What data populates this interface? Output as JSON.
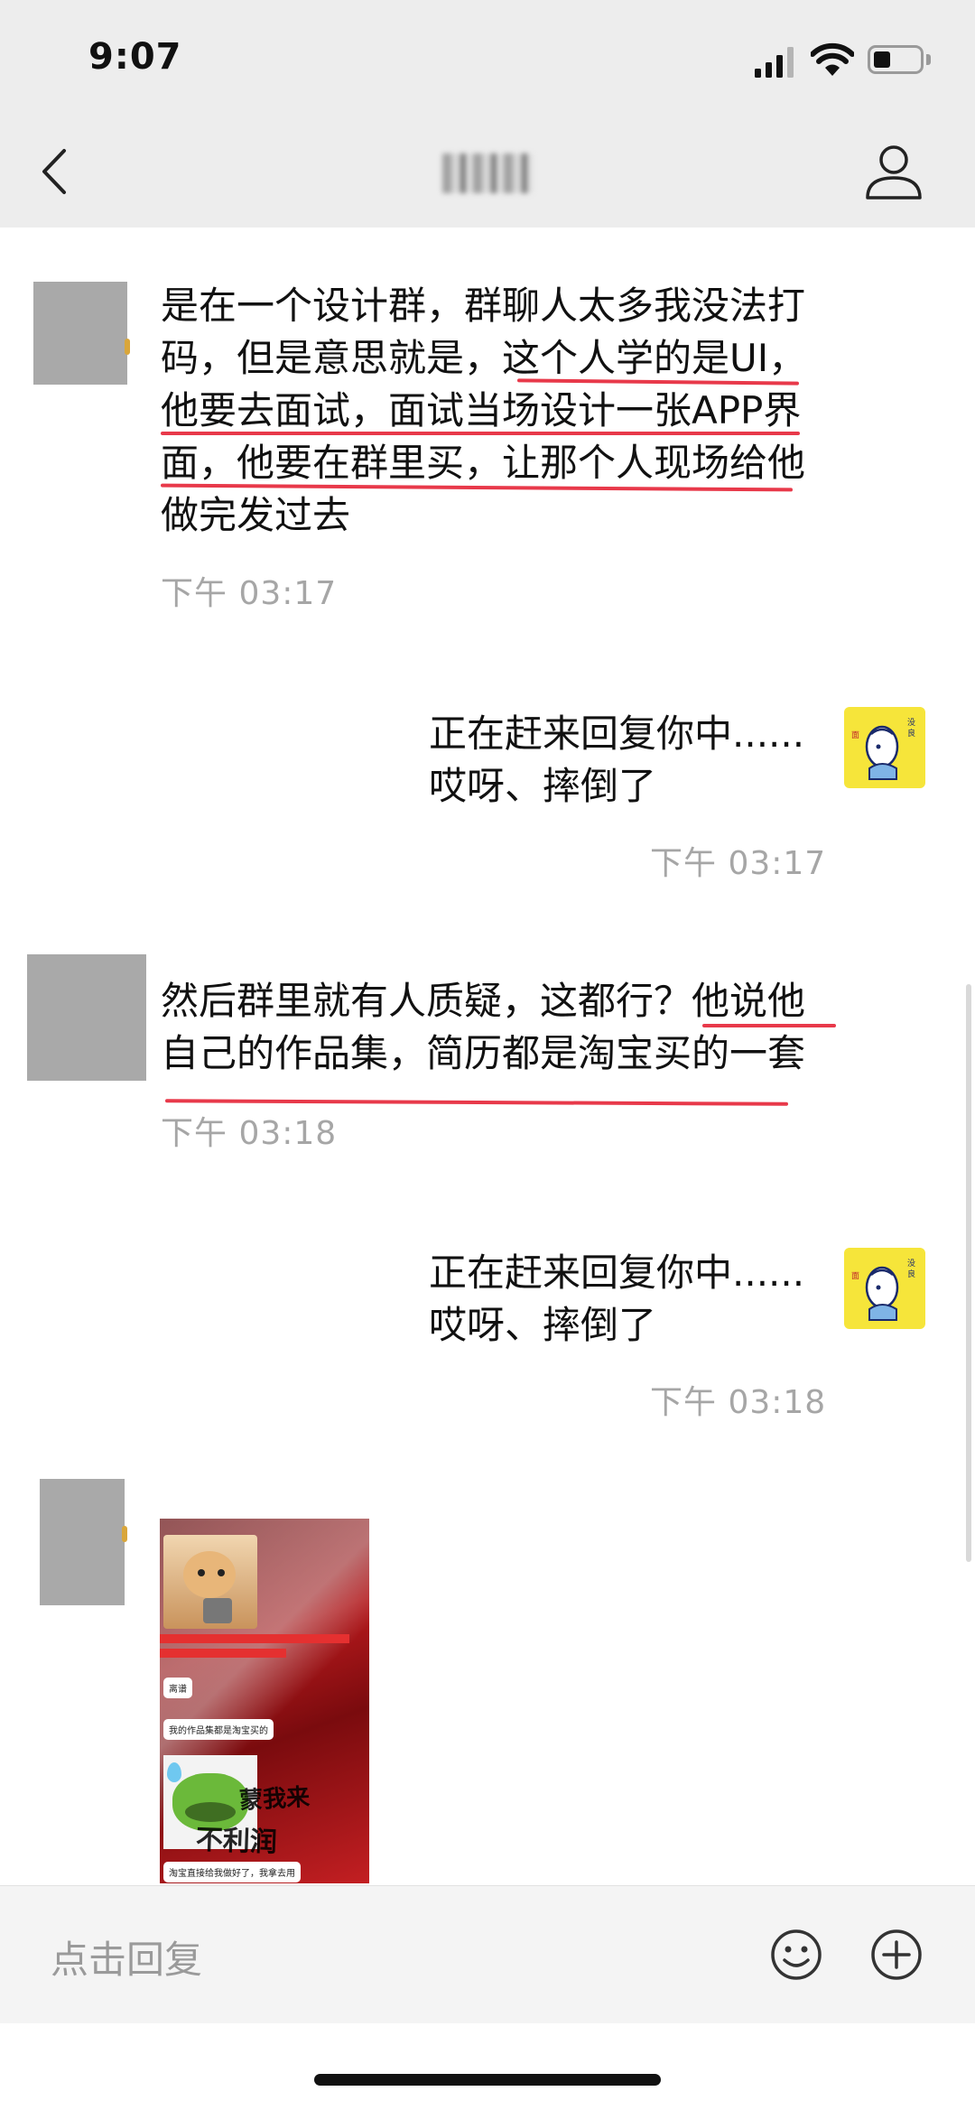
{
  "status_bar": {
    "time": "9:07"
  },
  "nav": {
    "title": ""
  },
  "messages": [
    {
      "side": "left",
      "lines": [
        "是在一个设计群，群聊人太多我没法打",
        "码，但是意思就是，这个人学的是UI，",
        "他要去面试，面试当场设计一张APP界",
        "面，他要在群里买，让那个人现场给他",
        "做完发过去"
      ],
      "time": "下午 03:17"
    },
    {
      "side": "right",
      "lines": [
        "正在赶来回复你中......",
        "哎呀、摔倒了"
      ],
      "time": "下午 03:17"
    },
    {
      "side": "left",
      "lines": [
        "然后群里就有人质疑，这都行？他说他",
        "自己的作品集，简历都是淘宝买的一套"
      ],
      "time": "下午 03:18"
    },
    {
      "side": "right",
      "lines": [
        "正在赶来回复你中......",
        "哎呀、摔倒了"
      ],
      "time": "下午 03:18"
    }
  ],
  "image_message": {
    "bubble1": "离谱",
    "bubble2": "我的作品集都是淘宝买的",
    "bubble3": "淘宝直接给我做好了，我拿去用",
    "scribble1": "蒙我来",
    "scribble2": "不利润"
  },
  "input": {
    "placeholder": "点击回复"
  },
  "colors": {
    "underline": "#e8394a",
    "my_avatar_bg": "#f6e53a",
    "timestamp": "#a6a6a6"
  }
}
